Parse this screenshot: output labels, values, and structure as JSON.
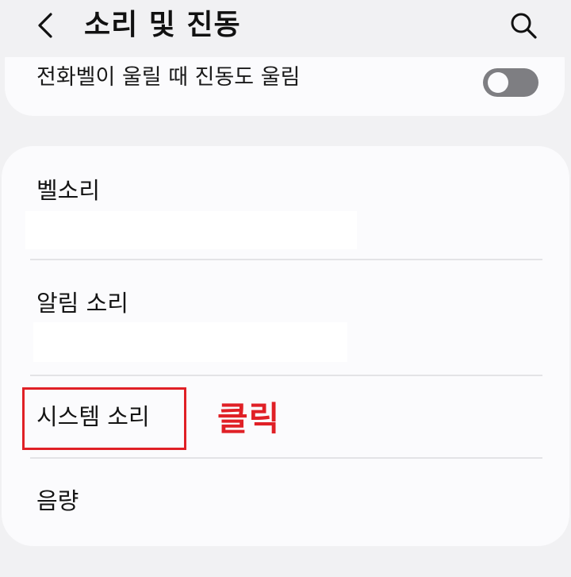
{
  "header": {
    "title": "소리 및 진동",
    "back_icon": "back-chevron-icon",
    "search_icon": "search-icon"
  },
  "top_card": {
    "label": "전화벨이 울릴 때 진동도 울림",
    "toggle_state": "off"
  },
  "items": [
    {
      "label": "벨소리"
    },
    {
      "label": "알림 소리"
    },
    {
      "label": "시스템 소리"
    },
    {
      "label": "음량"
    }
  ],
  "annotation": {
    "text": "클릭",
    "color": "#e02026"
  },
  "colors": {
    "background": "#f1f1f3",
    "card": "#fbfbfd",
    "divider": "#e3e3e6",
    "toggle_off": "#7e7e82",
    "highlight": "#e02026"
  }
}
